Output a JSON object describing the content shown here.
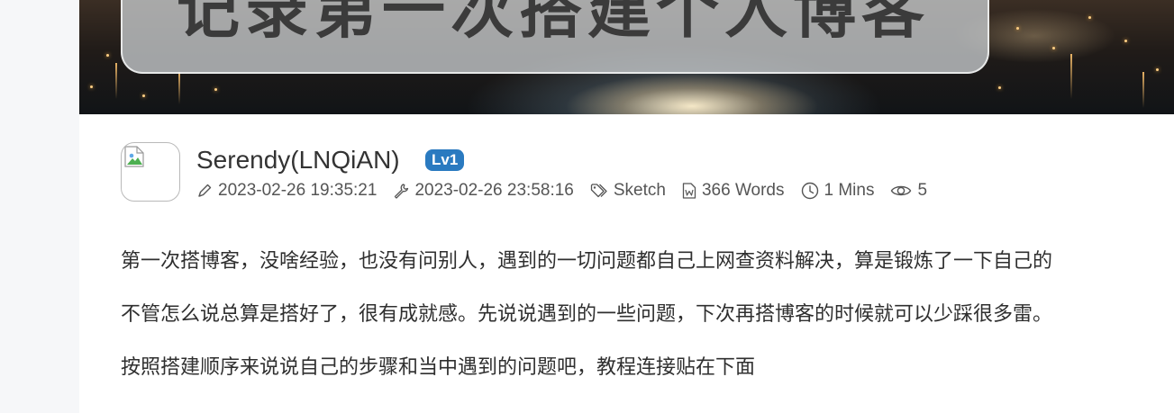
{
  "banner": {
    "title": "记录第一次搭建个人博客"
  },
  "post_meta": {
    "author_name": "Serendy(LNQiAN)",
    "level_badge": "Lv1",
    "created": "2023-02-26 19:35:21",
    "updated": "2023-02-26 23:58:16",
    "category": "Sketch",
    "word_count": "366 Words",
    "reading_time": "1 Mins",
    "views": "5"
  },
  "icons": [
    "image-placeholder-icon",
    "pen-icon",
    "wrench-icon",
    "tag-icon",
    "word-doc-icon",
    "clock-icon",
    "eye-icon"
  ],
  "colors": {
    "badge": "#2a7ac0",
    "text": "#2f2f2f",
    "meta_text": "#555555",
    "page_bg": "#f6f7f9"
  },
  "content": {
    "paragraphs": [
      "第一次搭博客，没啥经验，也没有问别人，遇到的一切问题都自己上网查资料解决，算是锻炼了一下自己的",
      "不管怎么说总算是搭好了，很有成就感。先说说遇到的一些问题，下次再搭博客的时候就可以少踩很多雷。",
      "按照搭建顺序来说说自己的步骤和当中遇到的问题吧，教程连接贴在下面"
    ]
  }
}
